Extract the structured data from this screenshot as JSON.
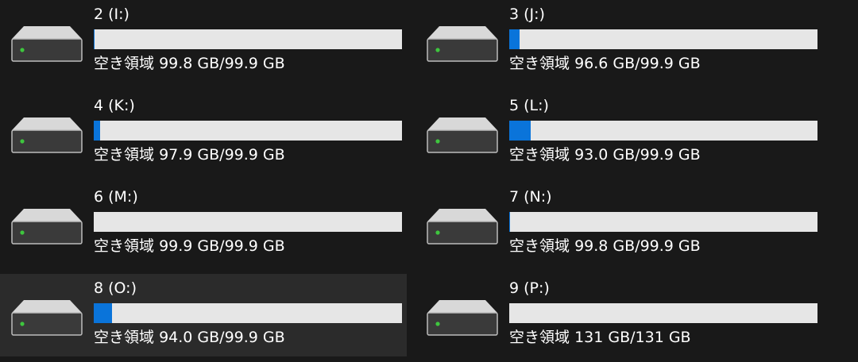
{
  "drives": [
    {
      "name": "2 (I:)",
      "free_label": "空き領域",
      "free": "99.8 GB/99.9 GB",
      "used_fraction": 0.001,
      "selected": false
    },
    {
      "name": "3 (J:)",
      "free_label": "空き領域",
      "free": "96.6 GB/99.9 GB",
      "used_fraction": 0.033,
      "selected": false
    },
    {
      "name": "4 (K:)",
      "free_label": "空き領域",
      "free": "97.9 GB/99.9 GB",
      "used_fraction": 0.02,
      "selected": false
    },
    {
      "name": "5 (L:)",
      "free_label": "空き領域",
      "free": "93.0 GB/99.9 GB",
      "used_fraction": 0.069,
      "selected": false
    },
    {
      "name": "6 (M:)",
      "free_label": "空き領域",
      "free": "99.9 GB/99.9 GB",
      "used_fraction": 0.0,
      "selected": false
    },
    {
      "name": "7 (N:)",
      "free_label": "空き領域",
      "free": "99.8 GB/99.9 GB",
      "used_fraction": 0.001,
      "selected": false
    },
    {
      "name": "8 (O:)",
      "free_label": "空き領域",
      "free": "94.0 GB/99.9 GB",
      "used_fraction": 0.059,
      "selected": true
    },
    {
      "name": "9 (P:)",
      "free_label": "空き領域",
      "free": "131 GB/131 GB",
      "used_fraction": 0.0,
      "selected": false
    }
  ],
  "colors": {
    "background": "#191919",
    "selected_background": "#2b2b2b",
    "bar_track": "#e6e6e6",
    "bar_fill": "#0a74da",
    "drive_led": "#3ec63e"
  },
  "icons": {
    "drive": "hard-drive-icon"
  }
}
